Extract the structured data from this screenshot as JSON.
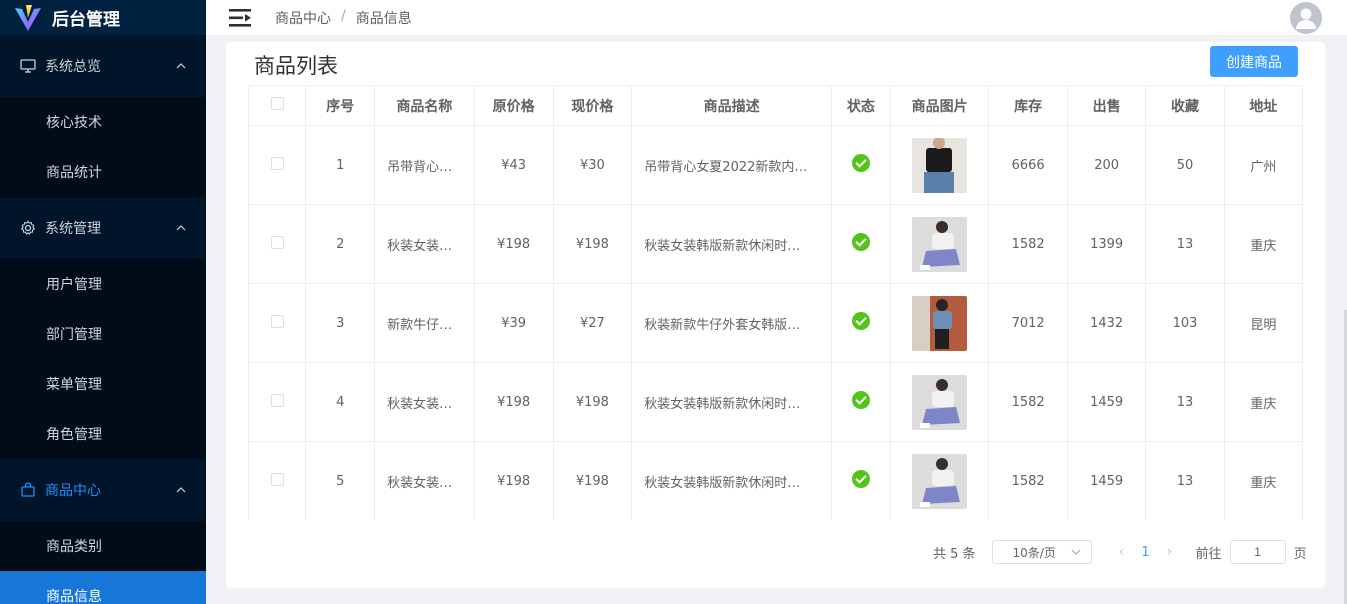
{
  "app": {
    "title": "后台管理"
  },
  "sidebar": {
    "groups": [
      {
        "label": "系统总览",
        "icon": "monitor-icon",
        "items": [
          "核心技术",
          "商品统计"
        ]
      },
      {
        "label": "系统管理",
        "icon": "gear-icon",
        "items": [
          "用户管理",
          "部门管理",
          "菜单管理",
          "角色管理"
        ]
      },
      {
        "label": "商品中心",
        "icon": "bag-icon",
        "items": [
          "商品类别",
          "商品信息"
        ]
      }
    ],
    "selected": "商品信息"
  },
  "header": {
    "breadcrumb": [
      "商品中心",
      "商品信息"
    ],
    "separator": "/"
  },
  "card": {
    "title": "商品列表",
    "create_label": "创建商品"
  },
  "table": {
    "headers": [
      "序号",
      "商品名称",
      "原价格",
      "现价格",
      "商品描述",
      "状态",
      "商品图片",
      "库存",
      "出售",
      "收藏",
      "地址"
    ],
    "rows": [
      {
        "index": "1",
        "name": "吊带背心…",
        "old_price": "¥43",
        "new_price": "¥30",
        "desc": "吊带背心女夏2022新款内…",
        "status": "ok",
        "image": "black-top",
        "stock": "6666",
        "sold": "200",
        "fav": "50",
        "addr": "广州"
      },
      {
        "index": "2",
        "name": "秋装女装…",
        "old_price": "¥198",
        "new_price": "¥198",
        "desc": "秋装女装韩版新款休闲时…",
        "status": "ok",
        "image": "grey-set",
        "stock": "1582",
        "sold": "1399",
        "fav": "13",
        "addr": "重庆"
      },
      {
        "index": "3",
        "name": "新款牛仔…",
        "old_price": "¥39",
        "new_price": "¥27",
        "desc": "秋装新款牛仔外套女韩版…",
        "status": "ok",
        "image": "denim-jacket",
        "stock": "7012",
        "sold": "1432",
        "fav": "103",
        "addr": "昆明"
      },
      {
        "index": "4",
        "name": "秋装女装…",
        "old_price": "¥198",
        "new_price": "¥198",
        "desc": "秋装女装韩版新款休闲时…",
        "status": "ok",
        "image": "grey-set",
        "stock": "1582",
        "sold": "1459",
        "fav": "13",
        "addr": "重庆"
      },
      {
        "index": "5",
        "name": "秋装女装…",
        "old_price": "¥198",
        "new_price": "¥198",
        "desc": "秋装女装韩版新款休闲时…",
        "status": "ok",
        "image": "grey-set",
        "stock": "1582",
        "sold": "1459",
        "fav": "13",
        "addr": "重庆"
      }
    ]
  },
  "pagination": {
    "total": "共 5 条",
    "page_size": "10条/页",
    "current": "1",
    "goto_label": "前往",
    "goto_value": "1",
    "page_suffix": "页"
  },
  "colors": {
    "sidebar_bg": "#001529",
    "submenu_bg": "#000c17",
    "selected_bg": "#1677d9",
    "primary": "#409eff",
    "success": "#52c41a"
  }
}
